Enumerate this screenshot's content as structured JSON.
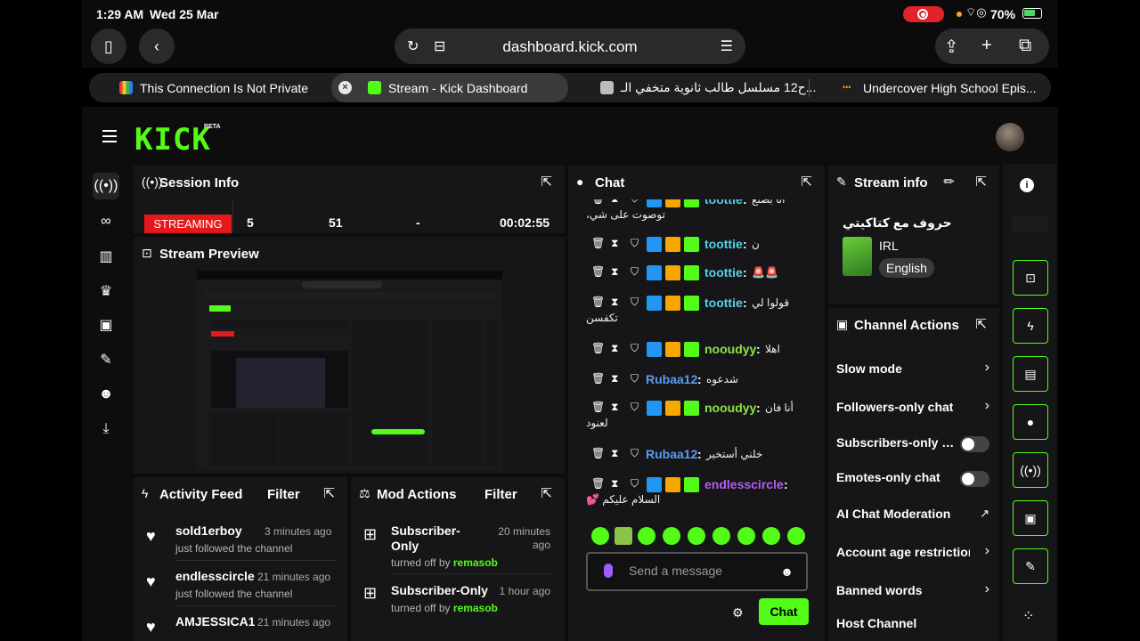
{
  "status_bar": {
    "time": "1:29 AM",
    "date": "Wed 25 Mar",
    "battery": "70%"
  },
  "browser": {
    "url": "dashboard.kick.com",
    "tabs": [
      {
        "label": "This Connection Is Not Private",
        "icon": "bar-chart-favicon-icon"
      },
      {
        "label": "Stream - Kick Dashboard",
        "icon": "kick-favicon-icon"
      },
      {
        "label": "ح12 مسلسل طالب ثانوية متخفي الـ...",
        "icon": "letter-a-favicon-icon"
      },
      {
        "label": "Undercover High School Epis...",
        "icon": "dots-favicon-icon"
      }
    ]
  },
  "kick": {
    "logo": "KICK",
    "beta": "BETA"
  },
  "session": {
    "title": "Session Info",
    "status": "STREAMING",
    "viewers": "5",
    "followers": "51",
    "subs": "-",
    "duration": "00:02:55"
  },
  "preview": {
    "title": "Stream Preview"
  },
  "activity": {
    "title": "Activity Feed",
    "filter": "Filter",
    "items": [
      {
        "name": "sold1erboy",
        "time": "3 minutes ago",
        "sub": "just followed the channel"
      },
      {
        "name": "endlesscircle",
        "time": "21 minutes ago",
        "sub": "just followed the channel"
      },
      {
        "name": "AMJESSICA1",
        "time": "21 minutes ago",
        "sub": ""
      }
    ]
  },
  "mod": {
    "title": "Mod Actions",
    "filter": "Filter",
    "items": [
      {
        "title": "Subscriber-Only",
        "time": "20 minutes ago",
        "sub_prefix": "turned off by",
        "user": "remasob"
      },
      {
        "title": "Subscriber-Only",
        "time": "1 hour ago",
        "sub_prefix": "turned off by",
        "user": "remasob"
      }
    ]
  },
  "chat": {
    "title": "Chat",
    "messages": [
      {
        "user": "toottie",
        "user_color": "#53d3e8",
        "text": "انا بصنع",
        "line2": "توصوت على شي،"
      },
      {
        "user": "toottie",
        "user_color": "#53d3e8",
        "text": "ن",
        "line2": ""
      },
      {
        "user": "toottie",
        "user_color": "#53d3e8",
        "text": "🚨🚨",
        "line2": ""
      },
      {
        "user": "toottie",
        "user_color": "#53d3e8",
        "text": "قولوا لي",
        "line2": "تكفسن"
      },
      {
        "user": "nooudyy",
        "user_color": "#8ee53f",
        "text": "اهلا",
        "line2": ""
      },
      {
        "user": "Rubaa12",
        "user_color": "#5b9bf0",
        "text": "شدعوه",
        "line2": ""
      },
      {
        "user": "nooudyy",
        "user_color": "#8ee53f",
        "text": "أنا فان",
        "line2": "لعنود"
      },
      {
        "user": "Rubaa12",
        "user_color": "#5b9bf0",
        "text": "خلني أستخير",
        "line2": ""
      },
      {
        "user": "endlesscircle",
        "user_color": "#b65cf0",
        "text": "",
        "line2": "السلام عليكم 💕"
      }
    ],
    "input_placeholder": "Send a message",
    "send": "Chat"
  },
  "stream_info": {
    "title": "Stream info",
    "stream_title": "حروف مع كتاكيتي",
    "category": "IRL",
    "language": "English"
  },
  "channel_actions": {
    "title": "Channel Actions",
    "items": [
      {
        "label": "Slow mode",
        "control": "chevron"
      },
      {
        "label": "Followers-only chat",
        "control": "chevron"
      },
      {
        "label": "Subscribers-only chat",
        "control": "toggle"
      },
      {
        "label": "Emotes-only chat",
        "control": "toggle"
      },
      {
        "label": "AI Chat Moderation",
        "control": "external"
      },
      {
        "label": "Account age restriction",
        "control": "chevron"
      },
      {
        "label": "Banned words",
        "control": "chevron"
      },
      {
        "label": "Host Channel",
        "control": "none"
      }
    ]
  },
  "colors": {
    "kick_green": "#53fc18",
    "streaming_red": "#e51919",
    "panel": "#161618"
  }
}
